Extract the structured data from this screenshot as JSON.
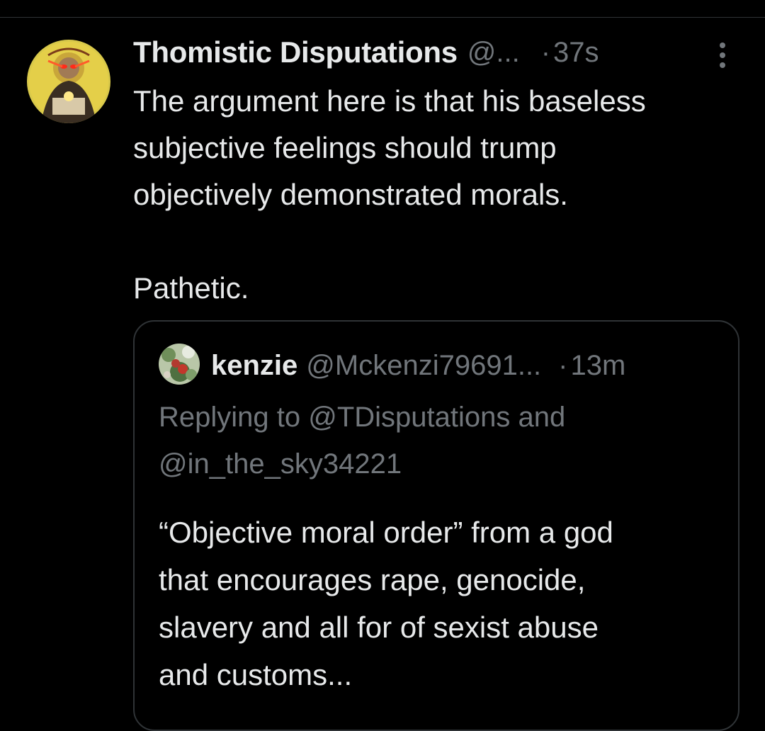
{
  "tweet": {
    "display_name": "Thomistic Disputations",
    "handle": "@...",
    "separator": "·",
    "time": "37s",
    "more_icon": "more-vertical-icon",
    "text": "The argument here is that his baseless\nsubjective feelings should trump\nobjectively demonstrated morals.\n\nPathetic."
  },
  "quote": {
    "display_name": "kenzie",
    "handle": "@Mckenzi79691...",
    "separator": "·",
    "time": "13m",
    "replying_line1": "Replying to @TDisputations and",
    "replying_line2": "@in_the_sky34221",
    "text_lines": [
      "“Objective moral order” from a god",
      "that encourages rape, genocide,",
      "slavery and all for of sexist abuse",
      "and customs..."
    ]
  },
  "colors": {
    "background": "#000000",
    "primary_text": "#e7e9ea",
    "secondary_text": "#71767b",
    "border": "#2f3336"
  }
}
